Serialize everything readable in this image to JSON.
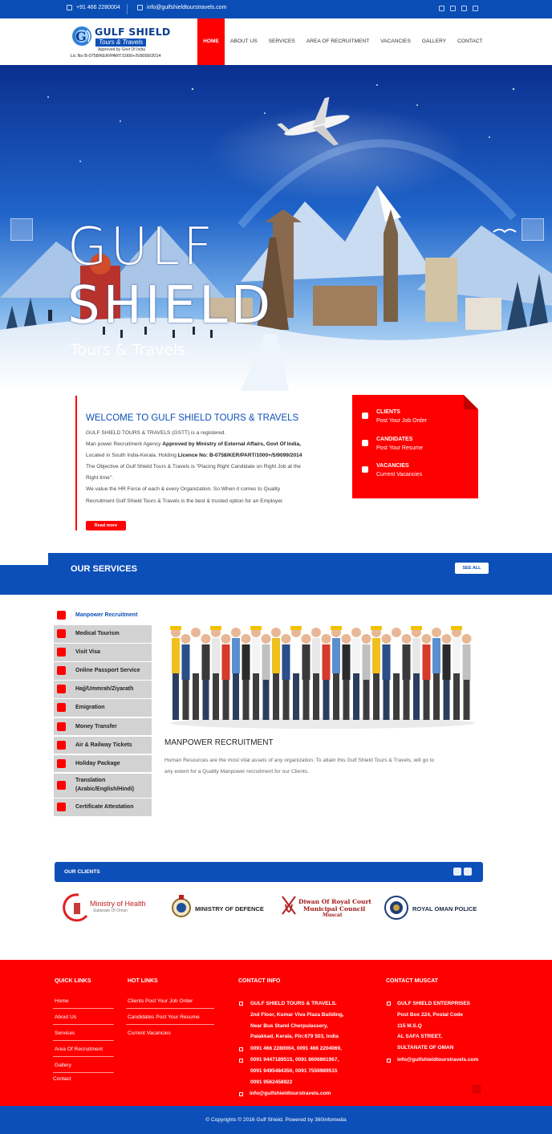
{
  "topbar": {
    "phone": "+91 466 2280004",
    "email": "info@gulfshieldtourstravels.com",
    "social_icons": [
      "facebook-icon",
      "twitter-icon",
      "google-plus-icon",
      "linkedin-icon"
    ]
  },
  "logo": {
    "title": "GULF SHIELD",
    "subtitle": "Tours & Travels",
    "approved": "Approved by Govt Of India",
    "license": "Lic No B-0758/KER/PART/1000+/5/9099/2014"
  },
  "nav": {
    "items": [
      "HOME",
      "ABOUT US",
      "SERVICES",
      "AREA OF RECRUITMENT",
      "VACANCIES",
      "GALLERY",
      "CONTACT"
    ],
    "active": "HOME"
  },
  "hero": {
    "line1": "GULF",
    "line2": "SHIELD",
    "line3": "Tours & Travels"
  },
  "welcome": {
    "title": "WELCOME TO GULF SHIELD TOURS & TRAVELS",
    "line1": "GULF SHIELD TOURS & TRAVELS (GSTT) is a registered.",
    "line2a": "Man power Recruitment Agency ",
    "line2b": "Approved by Ministry of External Affairs, Govt Of India,",
    "line3a": "Located in South India-Kerala. Holding ",
    "line3b": "Licence No: B-0758/KER/PART/1000+/5/9099/2014",
    "line4": "The Objective of Gulf Shield Tours & Travels is \"Placing Right Candidate on Right Job at the",
    "line5": "Right time\".",
    "line6": "We value the HR Force of each & every Organization. So When it comes to Quality",
    "line7": "Recruitment Gulf Shield Tours & Travels is the best & trusted option for an Employer.",
    "read_more": "Read more"
  },
  "quick_boxes": [
    {
      "title": "CLIENTS",
      "text": "Post Your Job Order"
    },
    {
      "title": "CANDIDATES",
      "text": "Post Your Resume"
    },
    {
      "title": "VACANCIES",
      "text": "Current Vacancies"
    }
  ],
  "services": {
    "title": "OUR SERVICES",
    "see_all": "SEE ALL",
    "items": [
      "Manpower Recruitment",
      "Medical Tourism",
      "Visit Visa",
      "Online Passport Service",
      "Hajj/Ummrah/Ziyarath",
      "Emigration",
      "Money Transfer",
      "Air & Railway Tickets",
      "Holiday Package",
      "Translation (Arabic/English/Hindi)",
      "Certificate Attestation"
    ],
    "active_heading": "MANPOWER RECRUITMENT",
    "active_desc1": "Human Resources are the most vital assets of any organization. To attain this Gulf Shield Tours & Travels, will go to",
    "active_desc2": "any extent for a Quality Manpower recruitment for our Clients."
  },
  "clients": {
    "title": "OUR CLIENTS",
    "logos": [
      {
        "name": "Ministry of Health",
        "sub": "Sultanate Of Oman"
      },
      {
        "name": "MINISTRY OF DEFENCE",
        "sub": ""
      },
      {
        "name": "Diwan Of Royal Court",
        "sub": "Municipal Council",
        "sub2": "Muscat"
      },
      {
        "name": "ROYAL OMAN POLICE",
        "sub": ""
      }
    ]
  },
  "footer": {
    "quick_links_title": "QUICK LINKS",
    "quick_links": [
      "Home",
      "About Us",
      "Services",
      "Area Of Recruitment",
      "Gallery",
      "Contact"
    ],
    "hot_links_title": "HOT LINKS",
    "hot_links": [
      "Clients Post Your Job Order",
      "Candidates Post Your Resume",
      "Current Vacancies"
    ],
    "contact_title": "CONTACT INFO",
    "contact_address": [
      "GULF SHIELD TOURS & TRAVELS.",
      "2nd Floor, Kumar Viva Plaza Building,",
      "Near Bus Stand Cherpulassery,",
      "Palakkad, Kerala, Pin:679 503, India"
    ],
    "contact_phone": "0091 466 2280004, 0091 466 2204069,",
    "contact_mobile": [
      "0091 9447189515, 0091 8606861967,",
      "0091 9495484350, 0091 7559989515",
      "0091 9562458922"
    ],
    "contact_email": "info@gulfshieldtourstravels.com",
    "muscat_title": "CONTACT MUSCAT",
    "muscat_address": [
      "GULF SHIELD ENTERPRISES",
      "Post Box 224, Postal Code",
      "115 M.S.Q",
      "AL SAFA STREET,",
      "SULTANATE OF OMAN"
    ],
    "muscat_email": "info@gulfshieldtourstravels.com",
    "copyright": "© Copyrights © 2016 Gulf Shield. Powered by 360infomedia"
  },
  "colors": {
    "brand_blue": "#0d4fb8",
    "brand_red": "#ff0000"
  }
}
